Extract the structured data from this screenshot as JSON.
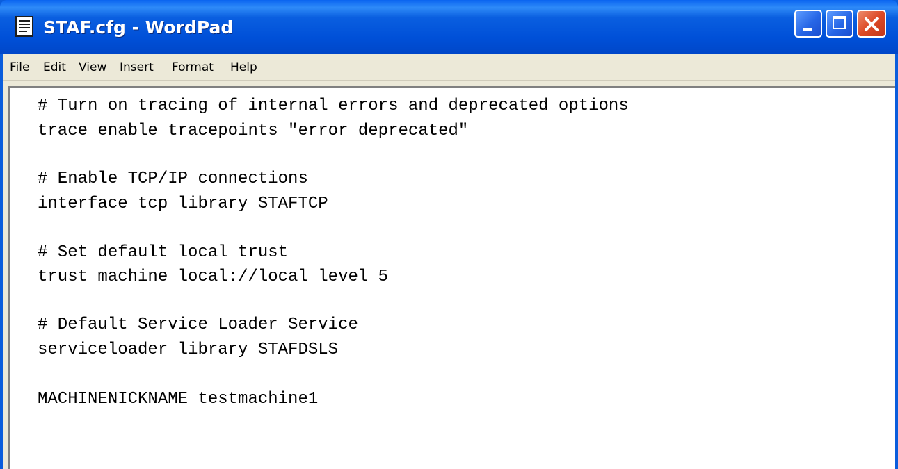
{
  "window": {
    "title": "STAF.cfg - WordPad",
    "icon": "wordpad-document-icon"
  },
  "caption_buttons": {
    "minimize": "minimize-icon",
    "maximize": "maximize-icon",
    "close": "close-icon"
  },
  "menubar": {
    "items": [
      {
        "label": "File"
      },
      {
        "label": "Edit"
      },
      {
        "label": "View"
      },
      {
        "label": "Insert"
      },
      {
        "label": "Format"
      },
      {
        "label": "Help"
      }
    ]
  },
  "document": {
    "lines": [
      "# Turn on tracing of internal errors and deprecated options",
      "trace enable tracepoints \"error deprecated\"",
      "",
      "# Enable TCP/IP connections",
      "interface tcp library STAFTCP",
      "",
      "# Set default local trust",
      "trust machine local://local level 5",
      "",
      "# Default Service Loader Service",
      "serviceloader library STAFDSLS",
      "",
      "MACHINENICKNAME testmachine1"
    ]
  },
  "colors": {
    "titlebar": "#0a5ddc",
    "menubar": "#ece9d8",
    "close_button": "#dd4a26",
    "editor_background": "#ffffff"
  }
}
